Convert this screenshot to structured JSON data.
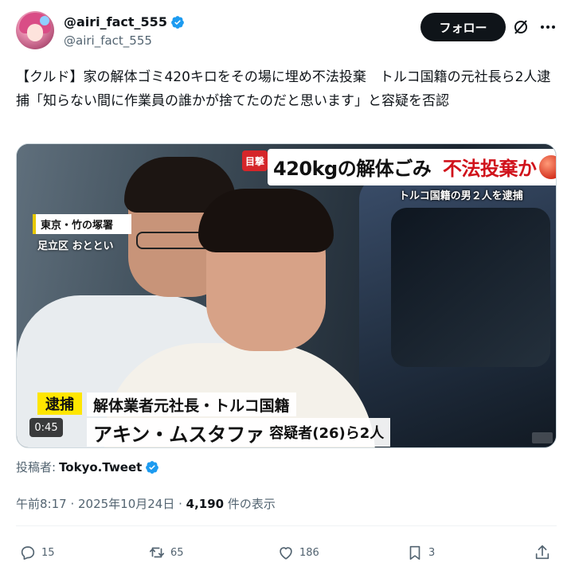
{
  "author": {
    "display_name": "@airi_fact_555",
    "handle": "@airi_fact_555",
    "verified": true
  },
  "follow_label": "フォロー",
  "tweet_text": "【クルド】家の解体ゴミ420キロをその場に埋め不法投棄　トルコ国籍の元社長ら2人逮捕「知らない間に作業員の誰かが捨てたのだと思います」と容疑を否認",
  "media": {
    "mokugeki": "目撃",
    "headline_main": "420kgの解体ごみ",
    "headline_red": "不法投棄か",
    "headline_sub": "トルコ国籍の男２人を逮捕",
    "location_1": "東京・竹の塚署",
    "location_2": "足立区 おととい",
    "taiho": "逮捕",
    "caption_1": "解体業者元社長・トルコ国籍",
    "caption_2_name": "アキン・ムスタファ",
    "caption_2_rest": "容疑者(26)ら2人",
    "duration": "0:45"
  },
  "posted_by": {
    "label": "投稿者:",
    "name": "Tokyo.Tweet"
  },
  "meta": {
    "time": "午前8:17",
    "date": "2025年10月24日",
    "views": "4,190",
    "views_label": "件の表示"
  },
  "actions": {
    "replies": "15",
    "reposts": "65",
    "likes": "186",
    "bookmarks": "3"
  },
  "colors": {
    "accent": "#1d9bf0",
    "text": "#0f1419",
    "secondary": "#536471"
  }
}
